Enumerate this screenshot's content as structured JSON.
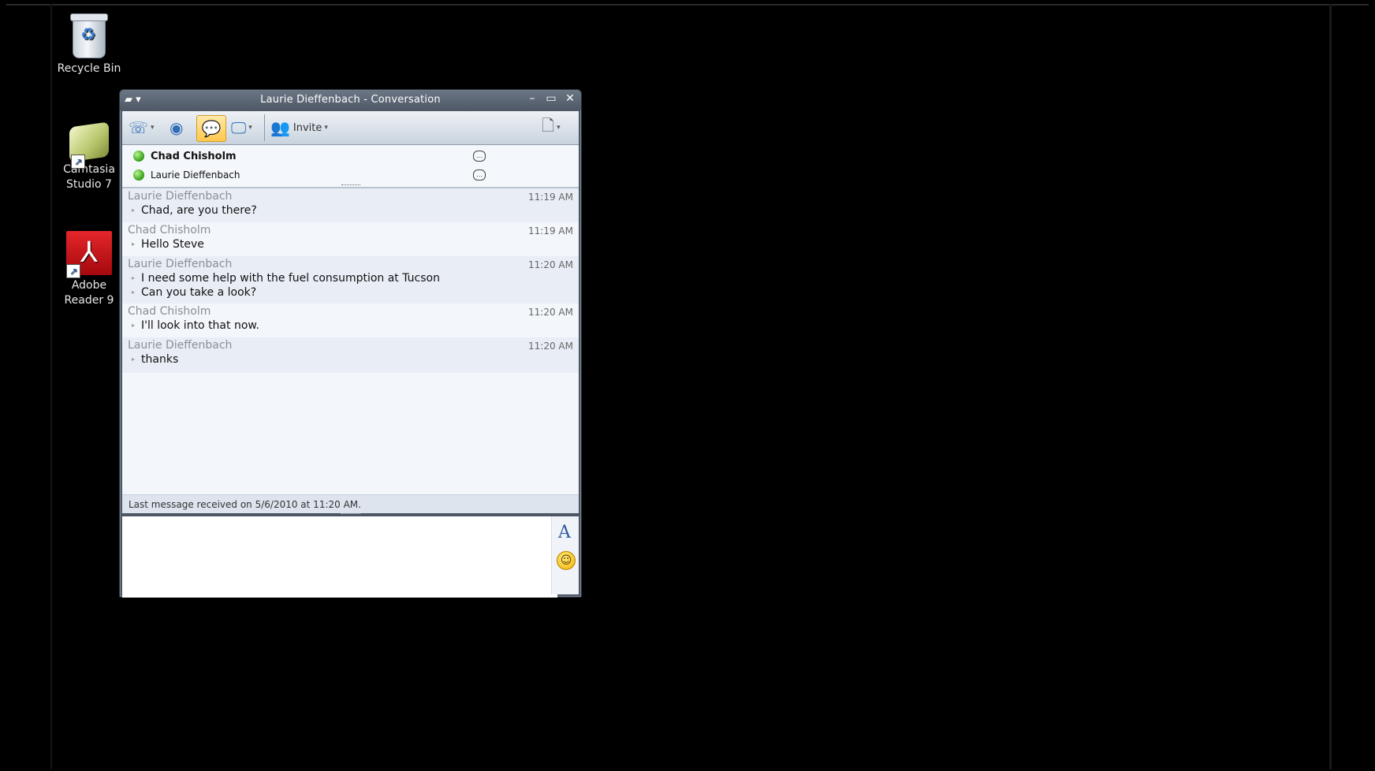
{
  "desktop": {
    "icons": [
      {
        "label": "Recycle Bin"
      },
      {
        "label": "Camtasia Studio 7"
      },
      {
        "label": "Adobe Reader 9"
      }
    ]
  },
  "window": {
    "title": "Laurie Dieffenbach - Conversation",
    "toolbar": {
      "invite_label": "Invite"
    },
    "participants": [
      {
        "name": "Chad Chisholm",
        "status_color": "#3aa81b"
      },
      {
        "name": "Laurie Dieffenbach",
        "status_color": "#3aa81b"
      }
    ],
    "messages": [
      {
        "sender": "Laurie Dieffenbach",
        "time": "11:19 AM",
        "lines": [
          "Chad, are you there?"
        ]
      },
      {
        "sender": "Chad Chisholm",
        "time": "11:19 AM",
        "lines": [
          "Hello Steve"
        ]
      },
      {
        "sender": "Laurie Dieffenbach",
        "time": "11:20 AM",
        "lines": [
          "I need some help with the fuel consumption at Tucson",
          "Can you take a look?"
        ]
      },
      {
        "sender": "Chad Chisholm",
        "time": "11:20 AM",
        "lines": [
          "I'll look into that now."
        ]
      },
      {
        "sender": "Laurie Dieffenbach",
        "time": "11:20 AM",
        "lines": [
          "thanks"
        ]
      }
    ],
    "status_text": "Last message received on 5/6/2010 at 11:20 AM.",
    "compose": {
      "value": "",
      "font_button": "A"
    }
  }
}
